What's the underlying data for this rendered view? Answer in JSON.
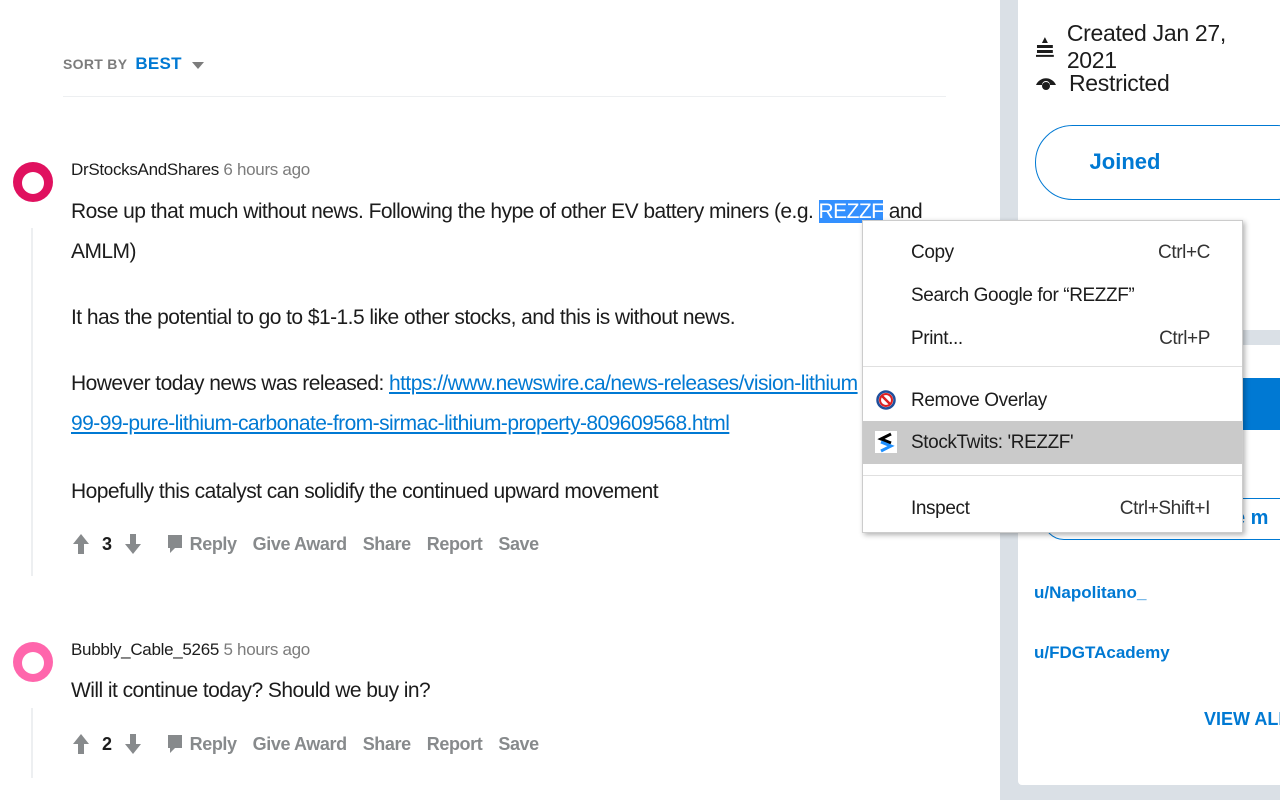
{
  "sort": {
    "label": "SORT BY",
    "value": "BEST"
  },
  "comments": [
    {
      "author": "DrStocksAndShares",
      "time": "6 hours ago",
      "paragraphs": {
        "p1a": "Rose up that much without news. Following the hype of other EV battery miners (e.g. ",
        "p1sel": "REZZF",
        "p1b": " and",
        "p1c": "AMLM)",
        "p2": "It has the potential to go to $1-1.5 like other stocks, and this is without news.",
        "p3": "However today news was released: ",
        "link1": "https://www.newswire.ca/news-releases/vision-lithium",
        "link2": "99-99-pure-lithium-carbonate-from-sirmac-lithium-property-809609568.html",
        "p4": "Hopefully this catalyst can solidify the continued upward movement"
      },
      "votes": "3"
    },
    {
      "author": "Bubbly_Cable_5265",
      "time": "5 hours ago",
      "text": "Will it continue today? Should we buy in?",
      "votes": "2"
    }
  ],
  "actions": {
    "reply": "Reply",
    "award": "Give Award",
    "share": "Share",
    "report": "Report",
    "save": "Save"
  },
  "sidebar": {
    "created": "Created Jan 27, 2021",
    "restricted": "Restricted",
    "joined": "Joined",
    "partial_button": "e m",
    "moderators": [
      "u/Napolitano_",
      "u/FDGTAcademy"
    ],
    "view_all": "VIEW ALL"
  },
  "context_menu": {
    "copy": "Copy",
    "copy_sc": "Ctrl+C",
    "search": "Search Google for “REZZF”",
    "print": "Print...",
    "print_sc": "Ctrl+P",
    "remove_overlay": "Remove Overlay",
    "stocktwits": "StockTwits: 'REZZF'",
    "inspect": "Inspect",
    "inspect_sc": "Ctrl+Shift+I"
  },
  "colors": {
    "accent": "#0079d3",
    "gutter": "#dae0e6",
    "highlight": "#cacaca"
  }
}
